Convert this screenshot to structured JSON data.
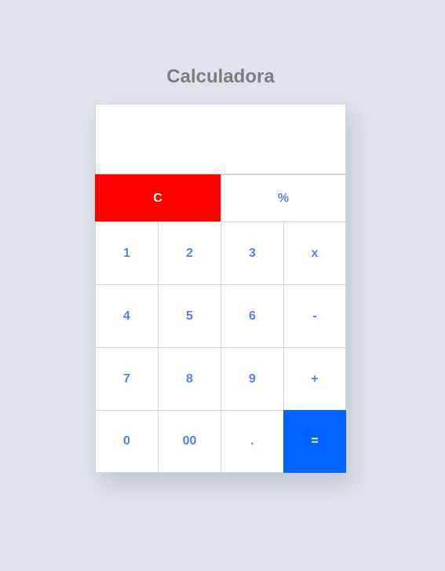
{
  "title": "Calculadora",
  "display": {
    "value": ""
  },
  "keys": {
    "clear": "C",
    "percent": "%",
    "one": "1",
    "two": "2",
    "three": "3",
    "multiply": "x",
    "four": "4",
    "five": "5",
    "six": "6",
    "minus": "-",
    "seven": "7",
    "eight": "8",
    "nine": "9",
    "plus": "+",
    "zero": "0",
    "double_zero": "00",
    "dot": ".",
    "equals": "="
  },
  "colors": {
    "clear": "#ff0000",
    "equals": "#0062ff",
    "key_text": "#5a80d6",
    "title_text": "#7d7d7d",
    "background": "#dfe3eb"
  }
}
